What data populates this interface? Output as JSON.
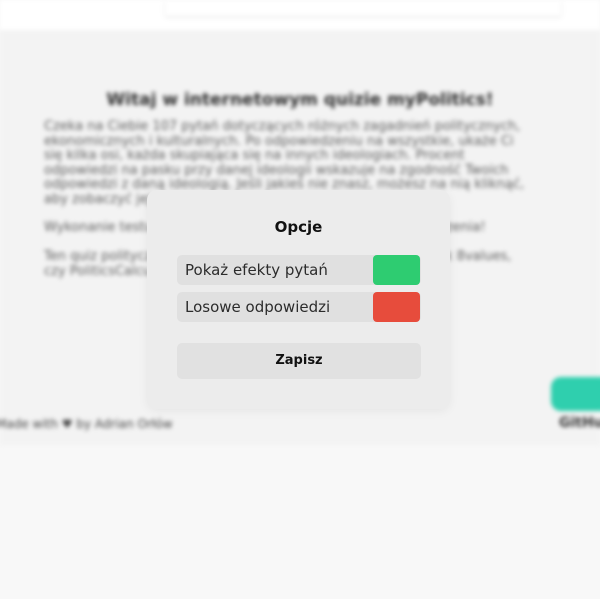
{
  "background": {
    "title": "Witaj w internetowym quizie myPolitics!",
    "paragraph1": "Czeka na Ciebie 107 pytań dotyczących różnych zagadnień politycznych, ekonomicznych i kulturalnych. Po odpowiedzeniu na wszystkie, ukaże Ci się kilka osi, każda skupiająca się na innych ideologiach. Procent odpowiedzi na pasku przy danej ideologii wskazuje na zgodność Twoich odpowiedzi z daną ideologią. Jeśli jakieś nie znasz, możesz na nią kliknąć, aby zobaczyć jej opis.",
    "paragraph2": "Wykonanie testu zajmuje zazwyczaj kilkanaście minut. Powodzenia!",
    "paragraph3": "Ten quiz polityczny jest inspirowany innymi quizami, takimi jak 8values, czy PoliticsCalculator.",
    "footer_left": "Made with ♥ by Adrian Orłów",
    "footer_right": "GitHub"
  },
  "modal": {
    "title": "Opcje",
    "options": [
      {
        "label": "Pokaż efekty pytań",
        "enabled": true,
        "color": "#2ecc71"
      },
      {
        "label": "Losowe odpowiedzi",
        "enabled": false,
        "color": "#e74c3c"
      }
    ],
    "save_label": "Zapisz"
  }
}
